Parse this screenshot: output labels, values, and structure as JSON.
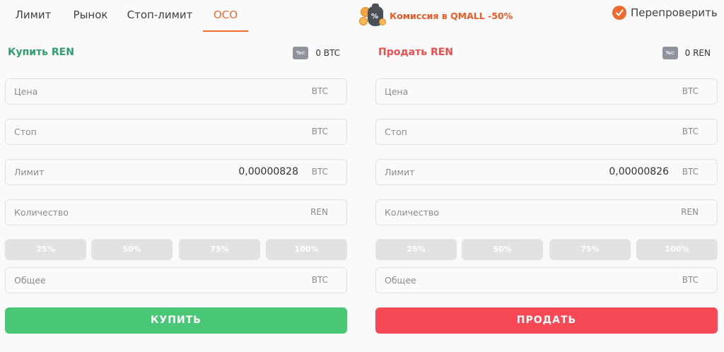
{
  "tabs": [
    "Лимит",
    "Рынок",
    "Стоп-лимит",
    "OCO"
  ],
  "active_tab": "OCO",
  "promo": {
    "text": "Комиссия в QMALL -50%"
  },
  "recheck": {
    "label": "Перепроверить",
    "checked": true
  },
  "colors": {
    "accent": "#ef6a2f",
    "buy": "#48c774",
    "sell": "#f74856",
    "buy_title": "#2f9e6a",
    "sell_title": "#ef4d4d"
  },
  "buy": {
    "title": "Купить REN",
    "balance": "0 BTC",
    "fields": {
      "price": {
        "placeholder": "Цена",
        "value": "",
        "unit": "BTC"
      },
      "stop": {
        "placeholder": "Стоп",
        "value": "",
        "unit": "BTC"
      },
      "limit": {
        "placeholder": "Лимит",
        "value": "0,00000828",
        "unit": "BTC"
      },
      "quantity": {
        "placeholder": "Количество",
        "value": "",
        "unit": "REN"
      },
      "total": {
        "placeholder": "Общее",
        "value": "",
        "unit": "BTC"
      }
    },
    "percents": [
      "25%",
      "50%",
      "75%",
      "100%"
    ],
    "action_label": "КУПИТЬ"
  },
  "sell": {
    "title": "Продать REN",
    "balance": "0 REN",
    "fields": {
      "price": {
        "placeholder": "Цена",
        "value": "",
        "unit": "BTC"
      },
      "stop": {
        "placeholder": "Стоп",
        "value": "",
        "unit": "BTC"
      },
      "limit": {
        "placeholder": "Лимит",
        "value": "0,00000826",
        "unit": "BTC"
      },
      "quantity": {
        "placeholder": "Количество",
        "value": "",
        "unit": "REN"
      },
      "total": {
        "placeholder": "Общее",
        "value": "",
        "unit": "BTC"
      }
    },
    "percents": [
      "25%",
      "50%",
      "75%",
      "100%"
    ],
    "action_label": "ПРОДАТЬ"
  }
}
